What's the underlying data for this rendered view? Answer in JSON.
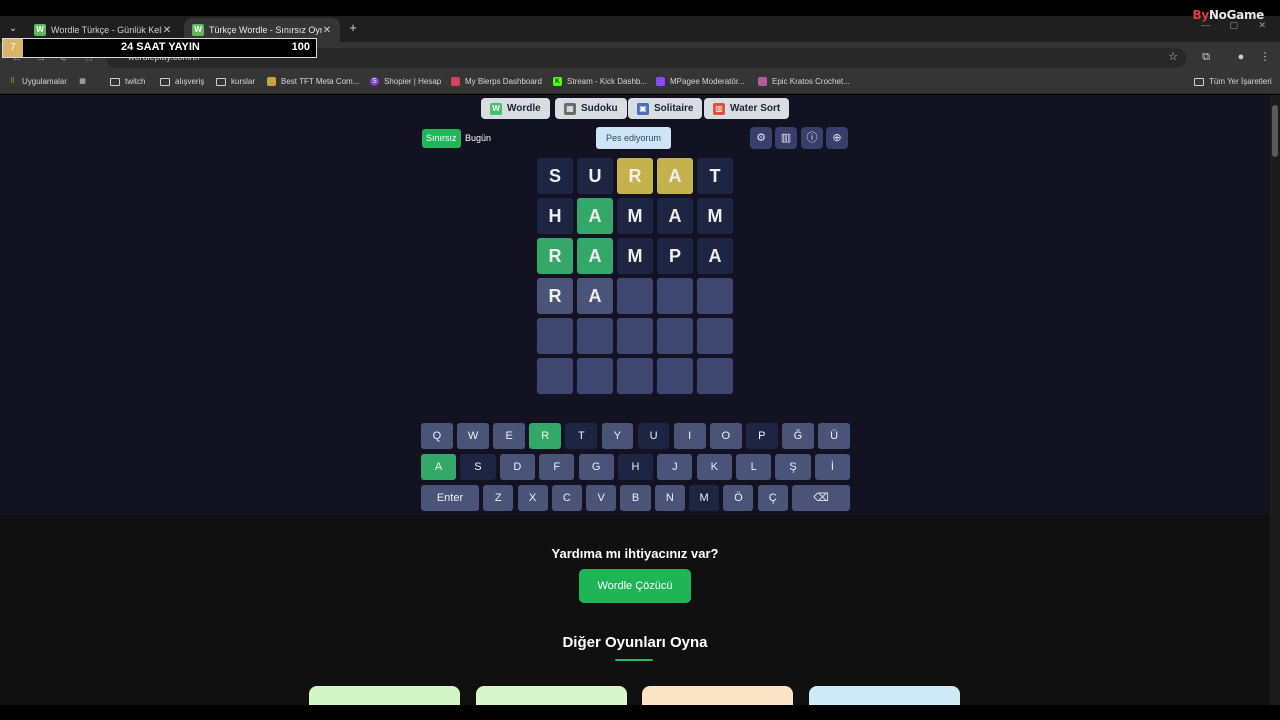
{
  "browser": {
    "tabs": [
      {
        "title": "Wordle Türkçe - Günlük Kelime",
        "icon": "W"
      },
      {
        "title": "Türkçe Wordle - Sınırsız Oyna",
        "icon": "W"
      }
    ],
    "url": "wordleplay.com/tr/",
    "brand": {
      "prefix": "By",
      "rest": "NoGame"
    },
    "bookmarks": [
      "Uygulamalar",
      "twitch",
      "alışveriş",
      "kurslar",
      "Best TFT Meta Com...",
      "Shopier | Hesap",
      "My Blerps Dashboard",
      "Stream - Kick Dashb...",
      "MPagee Moderatör...",
      "Epic Kratos Crochet..."
    ],
    "all_bookmarks": "Tüm Yer İşaretleri"
  },
  "stream_overlay": {
    "number": "7",
    "title": "24 SAAT YAYIN",
    "count": "100"
  },
  "game_nav": [
    {
      "label": "Wordle",
      "icon": "W",
      "color": "#45c06c"
    },
    {
      "label": "Sudoku",
      "icon": "▦",
      "color": "#6b6b6b"
    },
    {
      "label": "Solitaire",
      "icon": "▣",
      "color": "#4a6fb5"
    },
    {
      "label": "Water Sort",
      "icon": "▥",
      "color": "#d9533f"
    }
  ],
  "modes": {
    "unlimited": "Sınırsız",
    "today": "Bugün"
  },
  "give_up": "Pes ediyorum",
  "tools": [
    "settings-icon",
    "stats-icon",
    "info-icon",
    "add-icon"
  ],
  "board": [
    [
      {
        "l": "S",
        "s": "absent"
      },
      {
        "l": "U",
        "s": "absent"
      },
      {
        "l": "R",
        "s": "present"
      },
      {
        "l": "A",
        "s": "present"
      },
      {
        "l": "T",
        "s": "absent"
      }
    ],
    [
      {
        "l": "H",
        "s": "absent"
      },
      {
        "l": "A",
        "s": "correct"
      },
      {
        "l": "M",
        "s": "absent"
      },
      {
        "l": "A",
        "s": "absent"
      },
      {
        "l": "M",
        "s": "absent"
      }
    ],
    [
      {
        "l": "R",
        "s": "correct"
      },
      {
        "l": "A",
        "s": "correct"
      },
      {
        "l": "M",
        "s": "absent"
      },
      {
        "l": "P",
        "s": "absent"
      },
      {
        "l": "A",
        "s": "absent"
      }
    ],
    [
      {
        "l": "R",
        "s": "tbd"
      },
      {
        "l": "A",
        "s": "tbd"
      },
      {
        "l": "",
        "s": "empty"
      },
      {
        "l": "",
        "s": "empty"
      },
      {
        "l": "",
        "s": "empty"
      }
    ],
    [
      {
        "l": "",
        "s": "empty"
      },
      {
        "l": "",
        "s": "empty"
      },
      {
        "l": "",
        "s": "empty"
      },
      {
        "l": "",
        "s": "empty"
      },
      {
        "l": "",
        "s": "empty"
      }
    ],
    [
      {
        "l": "",
        "s": "empty"
      },
      {
        "l": "",
        "s": "empty"
      },
      {
        "l": "",
        "s": "empty"
      },
      {
        "l": "",
        "s": "empty"
      },
      {
        "l": "",
        "s": "empty"
      }
    ]
  ],
  "keyboard": [
    [
      {
        "k": "Q"
      },
      {
        "k": "W"
      },
      {
        "k": "E"
      },
      {
        "k": "R",
        "s": "correct"
      },
      {
        "k": "T",
        "s": "absent"
      },
      {
        "k": "Y"
      },
      {
        "k": "U",
        "s": "absent"
      },
      {
        "k": "I"
      },
      {
        "k": "O"
      },
      {
        "k": "P",
        "s": "absent"
      },
      {
        "k": "Ğ"
      },
      {
        "k": "Ü"
      }
    ],
    [
      {
        "k": "A",
        "s": "correct"
      },
      {
        "k": "S",
        "s": "absent"
      },
      {
        "k": "D"
      },
      {
        "k": "F"
      },
      {
        "k": "G"
      },
      {
        "k": "H",
        "s": "absent"
      },
      {
        "k": "J"
      },
      {
        "k": "K"
      },
      {
        "k": "L"
      },
      {
        "k": "Ş"
      },
      {
        "k": "İ"
      }
    ],
    [
      {
        "k": "Enter",
        "w": "wide"
      },
      {
        "k": "Z"
      },
      {
        "k": "X"
      },
      {
        "k": "C"
      },
      {
        "k": "V"
      },
      {
        "k": "B"
      },
      {
        "k": "N"
      },
      {
        "k": "M",
        "s": "absent"
      },
      {
        "k": "Ö"
      },
      {
        "k": "Ç"
      },
      {
        "k": "⌫",
        "w": "wide"
      }
    ]
  ],
  "help": {
    "title": "Yardıma mı ihtiyacınız var?",
    "button": "Wordle Çözücü"
  },
  "other_games": {
    "title": "Diğer Oyunları Oyna",
    "card_colors": [
      "#d3f6c9",
      "#d8f5cc",
      "#fbe3c6",
      "#cfeaf7"
    ]
  },
  "colors": {
    "correct": "#34a868",
    "present": "#c5b24c",
    "absent": "#1e2542",
    "unused_key": "#4a5478",
    "page_bg": "#121222"
  }
}
